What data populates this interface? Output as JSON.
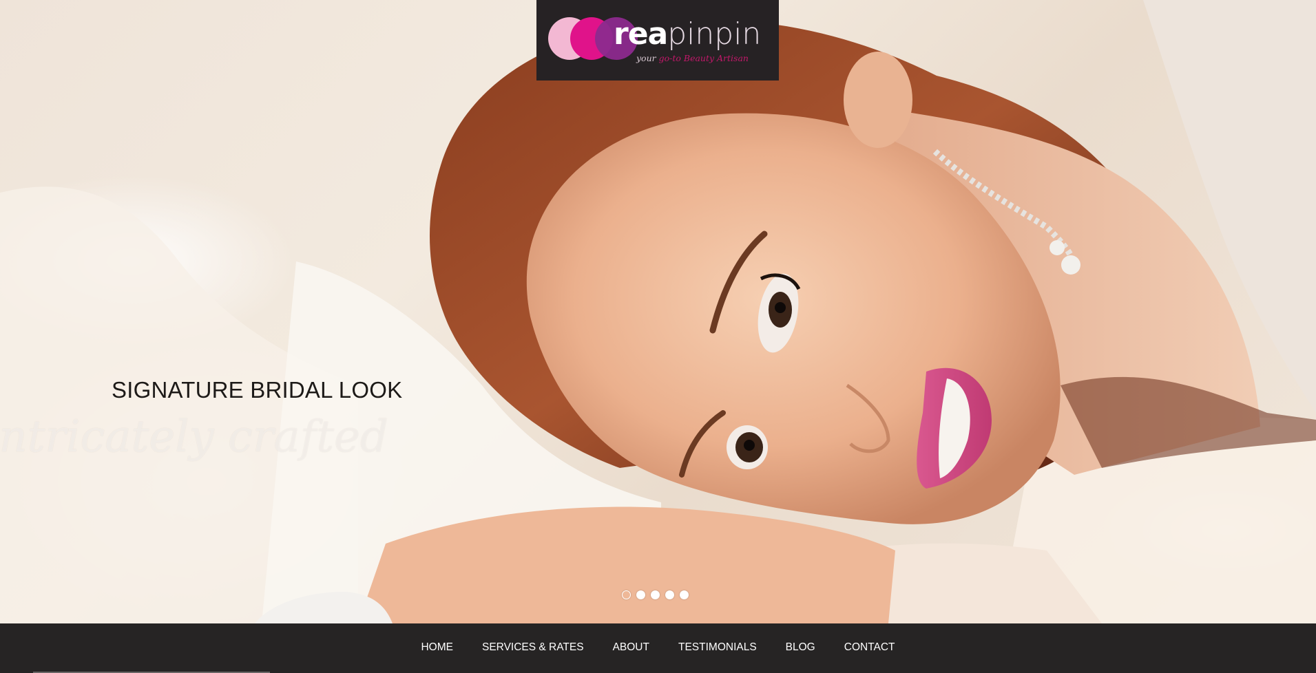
{
  "logo": {
    "word_primary": "rea",
    "word_secondary": "pinpin",
    "tagline_part1": "your",
    "tagline_part2": "go-to Beauty Artisan",
    "colors": {
      "circle1": "#f3b8d3",
      "circle2": "#e0138a",
      "circle3": "#8c2a8e",
      "background": "#262224"
    }
  },
  "hero": {
    "title": "SIGNATURE BRIDAL LOOK",
    "script": "intricately crafted",
    "slides_count": 5,
    "active_slide": 1
  },
  "nav": {
    "items": [
      "HOME",
      "SERVICES & RATES",
      "ABOUT",
      "TESTIMONIALS",
      "BLOG",
      "CONTACT"
    ]
  }
}
